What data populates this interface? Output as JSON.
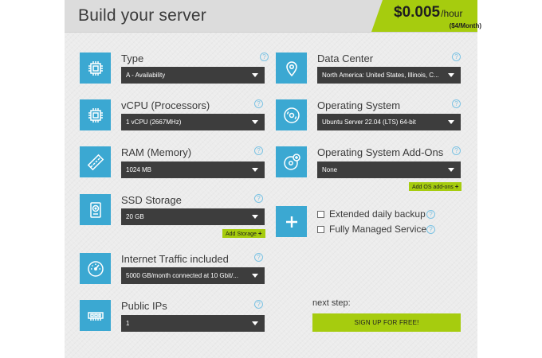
{
  "header": {
    "title": "Build your server",
    "price": "$0.005",
    "price_unit": "/hour",
    "price_monthly": "($4/Month)"
  },
  "fields": {
    "type": {
      "label": "Type",
      "value": "A - Availability",
      "icon": "chip-icon"
    },
    "vcpu": {
      "label": "vCPU (Processors)",
      "value": "1 vCPU (2667MHz)",
      "icon": "processor-icon"
    },
    "ram": {
      "label": "RAM (Memory)",
      "value": "1024 MB",
      "icon": "memory-icon"
    },
    "ssd": {
      "label": "SSD Storage",
      "value": "20 GB",
      "icon": "disk-icon",
      "add_button": "Add Storage"
    },
    "traffic": {
      "label": "Internet Traffic included",
      "value": "5000 GB/month connected at 10 Gbit/...",
      "icon": "speedometer-icon"
    },
    "ips": {
      "label": "Public IPs",
      "value": "1",
      "icon": "network-card-icon"
    },
    "datacenter": {
      "label": "Data Center",
      "value": "North America: United States, Illinois, C...",
      "icon": "map-pin-icon"
    },
    "os": {
      "label": "Operating System",
      "value": "Ubuntu Server 22.04 (LTS) 64-bit",
      "icon": "cd-icon"
    },
    "os_addons": {
      "label": "Operating System Add-Ons",
      "value": "None",
      "icon": "cd-plus-icon",
      "add_button": "Add OS add-ons"
    }
  },
  "extras": {
    "icon": "plus-icon",
    "options": [
      {
        "label": "Extended daily backup",
        "checked": false
      },
      {
        "label": "Fully Managed Service",
        "checked": false
      }
    ]
  },
  "help_glyph": "?",
  "next_step": "next step:",
  "signup_label": "SIGN UP FOR FREE!",
  "colors": {
    "accent_green": "#a6cc0e",
    "icon_blue": "#3ba8d2",
    "select_bg": "#3d3d3d"
  }
}
